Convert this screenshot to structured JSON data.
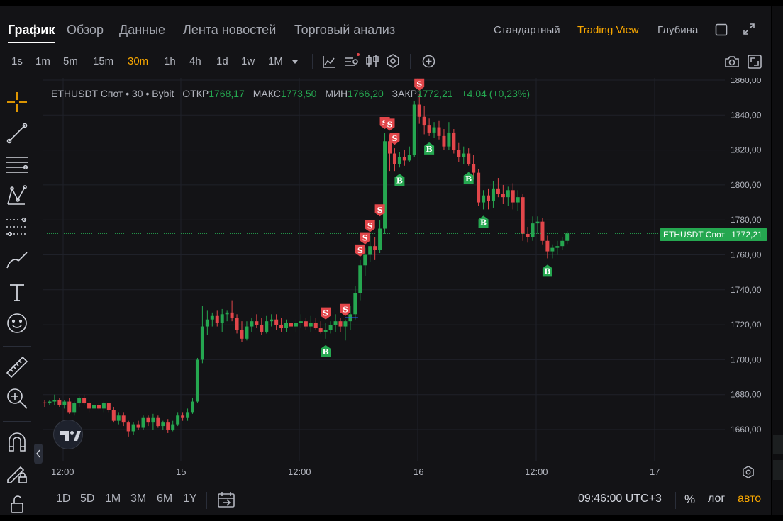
{
  "top_tabs": [
    "График",
    "Обзор",
    "Данные",
    "Лента новостей",
    "Торговый анализ"
  ],
  "view_tabs": [
    "Стандартный",
    "Trading View",
    "Глубина"
  ],
  "timeframes": [
    "1s",
    "1m",
    "5m",
    "15m",
    "30m",
    "1h",
    "4h",
    "1d",
    "1w",
    "1M"
  ],
  "active_timeframe": "30m",
  "legend": {
    "symbol": "ETHUSDT Спот • 30 • Bybit",
    "open_label": "ОТКР",
    "open": "1768,17",
    "high_label": "МАКС",
    "high": "1773,50",
    "low_label": "МИН",
    "low": "1766,20",
    "close_label": "ЗАКР",
    "close": "1772,21",
    "change": "+4,04 (+0,23%)"
  },
  "price_labels": [
    "1860,00",
    "1840,00",
    "1820,00",
    "1800,00",
    "1780,00",
    "1760,00",
    "1740,00",
    "1720,00",
    "1700,00",
    "1680,00",
    "1660,00"
  ],
  "last_price": {
    "symbol_tag": "ETHUSDT Спот",
    "value": "1772,21"
  },
  "time_labels": [
    "12:00",
    "15",
    "12:00",
    "16",
    "12:00",
    "17"
  ],
  "ranges": [
    "1D",
    "5D",
    "1M",
    "3M",
    "6M",
    "1Y"
  ],
  "clock": "09:46:00 UTC+3",
  "scale_options": {
    "percent": "%",
    "log": "лог",
    "auto": "авто"
  },
  "marker_labels": {
    "sell": "S",
    "buy": "B"
  },
  "colors": {
    "up": "#25a750",
    "down": "#e2464a",
    "accent": "#f7a600",
    "bg": "#131316"
  },
  "chart_data": {
    "type": "candlestick",
    "ylim": [
      1650,
      1860
    ],
    "candles": [
      [
        1675.5,
        1677,
        1673,
        1675
      ],
      [
        1675,
        1677,
        1674,
        1676
      ],
      [
        1676,
        1680,
        1674,
        1677
      ],
      [
        1677,
        1678,
        1673,
        1674
      ],
      [
        1674,
        1677,
        1672,
        1676
      ],
      [
        1676,
        1678,
        1669,
        1670
      ],
      [
        1670,
        1676,
        1668,
        1675
      ],
      [
        1675,
        1679,
        1673,
        1678
      ],
      [
        1678,
        1680,
        1674,
        1675
      ],
      [
        1675,
        1677,
        1670,
        1672
      ],
      [
        1672,
        1676,
        1671,
        1674
      ],
      [
        1674,
        1675,
        1671,
        1672
      ],
      [
        1672,
        1676,
        1670,
        1675
      ],
      [
        1675,
        1675,
        1670,
        1671
      ],
      [
        1671,
        1673,
        1664,
        1665
      ],
      [
        1665,
        1670,
        1663,
        1668
      ],
      [
        1668,
        1670,
        1662,
        1664
      ],
      [
        1664,
        1665,
        1656,
        1659
      ],
      [
        1659,
        1664,
        1657,
        1663
      ],
      [
        1663,
        1665,
        1660,
        1661
      ],
      [
        1661,
        1668,
        1660,
        1667
      ],
      [
        1667,
        1668,
        1662,
        1664
      ],
      [
        1664,
        1669,
        1660,
        1667
      ],
      [
        1667,
        1668,
        1661,
        1662
      ],
      [
        1662,
        1665,
        1660,
        1664
      ],
      [
        1664,
        1666,
        1658,
        1660
      ],
      [
        1660,
        1665,
        1659,
        1663
      ],
      [
        1663,
        1670,
        1662,
        1668
      ],
      [
        1668,
        1670,
        1665,
        1667
      ],
      [
        1667,
        1672,
        1665,
        1670
      ],
      [
        1670,
        1678,
        1669,
        1676
      ],
      [
        1676,
        1701,
        1675,
        1700
      ],
      [
        1700,
        1731,
        1698,
        1719
      ],
      [
        1719,
        1728,
        1714,
        1723
      ],
      [
        1723,
        1727,
        1719,
        1725
      ],
      [
        1725,
        1728,
        1719,
        1721
      ],
      [
        1721,
        1729,
        1716,
        1726
      ],
      [
        1726,
        1728,
        1722,
        1727
      ],
      [
        1727,
        1734,
        1722,
        1724
      ],
      [
        1724,
        1726,
        1715,
        1717
      ],
      [
        1717,
        1722,
        1710,
        1712
      ],
      [
        1712,
        1722,
        1711,
        1719
      ],
      [
        1719,
        1724,
        1716,
        1722
      ],
      [
        1722,
        1726,
        1718,
        1720
      ],
      [
        1720,
        1724,
        1714,
        1716
      ],
      [
        1716,
        1725,
        1715,
        1722
      ],
      [
        1722,
        1726,
        1719,
        1723
      ],
      [
        1723,
        1726,
        1717,
        1720
      ],
      [
        1720,
        1724,
        1716,
        1718
      ],
      [
        1718,
        1723,
        1716,
        1721
      ],
      [
        1721,
        1724,
        1717,
        1719
      ],
      [
        1719,
        1723,
        1716,
        1721
      ],
      [
        1721,
        1726,
        1718,
        1722
      ],
      [
        1722,
        1724,
        1717,
        1719
      ],
      [
        1719,
        1725,
        1716,
        1721
      ],
      [
        1721,
        1724,
        1717,
        1718
      ],
      [
        1718,
        1722,
        1715,
        1716
      ],
      [
        1716,
        1721,
        1712,
        1717
      ],
      [
        1717,
        1722,
        1715,
        1720
      ],
      [
        1720,
        1726,
        1716,
        1722
      ],
      [
        1722,
        1724,
        1716,
        1719
      ],
      [
        1719,
        1723,
        1711,
        1722
      ],
      [
        1722,
        1731,
        1717,
        1726
      ],
      [
        1726,
        1742,
        1723,
        1738
      ],
      [
        1738,
        1757,
        1734,
        1754
      ],
      [
        1754,
        1764,
        1748,
        1760
      ],
      [
        1760,
        1771,
        1756,
        1765
      ],
      [
        1765,
        1770,
        1757,
        1763
      ],
      [
        1763,
        1780,
        1761,
        1775
      ],
      [
        1775,
        1830,
        1772,
        1825
      ],
      [
        1825,
        1829,
        1808,
        1818
      ],
      [
        1818,
        1821,
        1808,
        1812
      ],
      [
        1812,
        1819,
        1810,
        1816
      ],
      [
        1816,
        1820,
        1811,
        1814
      ],
      [
        1814,
        1822,
        1813,
        1817
      ],
      [
        1817,
        1848,
        1816,
        1846
      ],
      [
        1846,
        1852,
        1835,
        1839
      ],
      [
        1839,
        1845,
        1829,
        1834
      ],
      [
        1834,
        1838,
        1828,
        1830
      ],
      [
        1830,
        1836,
        1827,
        1833
      ],
      [
        1833,
        1837,
        1826,
        1828
      ],
      [
        1828,
        1832,
        1820,
        1822
      ],
      [
        1822,
        1836,
        1820,
        1830
      ],
      [
        1830,
        1832,
        1818,
        1820
      ],
      [
        1820,
        1824,
        1813,
        1816
      ],
      [
        1816,
        1822,
        1812,
        1818
      ],
      [
        1818,
        1821,
        1811,
        1812
      ],
      [
        1812,
        1817,
        1803,
        1807
      ],
      [
        1807,
        1809,
        1788,
        1790
      ],
      [
        1790,
        1797,
        1786,
        1794
      ],
      [
        1794,
        1798,
        1786,
        1791
      ],
      [
        1791,
        1802,
        1787,
        1798
      ],
      [
        1798,
        1804,
        1793,
        1795
      ],
      [
        1795,
        1800,
        1789,
        1793
      ],
      [
        1793,
        1799,
        1788,
        1797
      ],
      [
        1797,
        1801,
        1786,
        1790
      ],
      [
        1790,
        1797,
        1785,
        1793
      ],
      [
        1793,
        1795,
        1768,
        1772
      ],
      [
        1772,
        1776,
        1767,
        1770
      ],
      [
        1770,
        1782,
        1768,
        1778
      ],
      [
        1778,
        1782,
        1772,
        1779
      ],
      [
        1779,
        1781,
        1766,
        1768
      ],
      [
        1768,
        1771,
        1758,
        1762
      ],
      [
        1762,
        1766,
        1758,
        1764
      ],
      [
        1764,
        1768,
        1760,
        1765
      ],
      [
        1765,
        1770,
        1763,
        1768
      ],
      [
        1768,
        1773.5,
        1766.2,
        1772.21
      ]
    ],
    "markers": [
      {
        "i": 57,
        "type": "S",
        "pos": "above"
      },
      {
        "i": 57,
        "type": "B",
        "pos": "below"
      },
      {
        "i": 61,
        "type": "S",
        "pos": "above"
      },
      {
        "i": 64,
        "type": "S",
        "pos": "above"
      },
      {
        "i": 65,
        "type": "S",
        "pos": "above"
      },
      {
        "i": 66,
        "type": "S",
        "pos": "above"
      },
      {
        "i": 68,
        "type": "S",
        "pos": "above"
      },
      {
        "i": 69,
        "type": "S",
        "pos": "above"
      },
      {
        "i": 70,
        "type": "S",
        "pos": "above"
      },
      {
        "i": 71,
        "type": "S",
        "pos": "above"
      },
      {
        "i": 72,
        "type": "B",
        "pos": "below"
      },
      {
        "i": 76,
        "type": "S",
        "pos": "above"
      },
      {
        "i": 78,
        "type": "B",
        "pos": "below"
      },
      {
        "i": 86,
        "type": "B",
        "pos": "below"
      },
      {
        "i": 89,
        "type": "B",
        "pos": "below"
      },
      {
        "i": 102,
        "type": "B",
        "pos": "below"
      }
    ]
  }
}
